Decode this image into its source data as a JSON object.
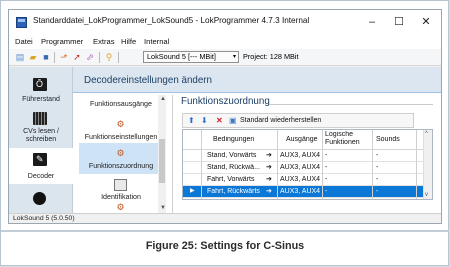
{
  "window": {
    "title": "Standarddatei_LokProgrammer_LokSound5 - LokProgrammer 4.7.3 Internal",
    "controls": [
      "–",
      "☐",
      "✕"
    ]
  },
  "menu": {
    "items": [
      "Datei",
      "Programmer",
      "Extras",
      "Hilfe",
      "Internal"
    ]
  },
  "toolbar": {
    "decoder_select": "LokSound 5 [--- MBit]",
    "project_label": "Project:",
    "project_value": "128 MBit",
    "icons": [
      "new-file-icon",
      "open-folder-icon",
      "save-icon",
      "read-icon",
      "write-icon",
      "undo-icon",
      "tools-icon"
    ]
  },
  "sidebar": {
    "items": [
      {
        "label": "Führerstand",
        "icon": "cab-icon"
      },
      {
        "label": "CVs lesen / schreiben",
        "icon": "cv-icon"
      },
      {
        "label": "Decoder",
        "icon": "decoder-icon",
        "active": true
      },
      {
        "label": "",
        "icon": "sound-icon"
      }
    ]
  },
  "main": {
    "header": "Decodereinstellungen ändern",
    "categories": [
      {
        "label": "Funktionsausgänge"
      },
      {
        "label": "Funktionseinstellungen"
      },
      {
        "label": "Funktionszuordnung",
        "selected": true
      },
      {
        "label": "Identifikation"
      }
    ],
    "section_title": "Funktionszuordnung",
    "restore_label": "Standard wiederherstellen",
    "table": {
      "columns": [
        "Bedingungen",
        "Ausgänge",
        "Logische Funktionen",
        "Sounds"
      ],
      "rows": [
        {
          "bedingungen": "Stand, Vorwärts",
          "ausgaenge": "AUX3, AUX4",
          "logisch": "-",
          "sounds": "-",
          "selected": false
        },
        {
          "bedingungen": "Stand, Rückwä...",
          "ausgaenge": "AUX3, AUX4",
          "logisch": "-",
          "sounds": "-",
          "selected": false
        },
        {
          "bedingungen": "Fahrt, Vorwärts",
          "ausgaenge": "AUX3, AUX4",
          "logisch": "-",
          "sounds": "-",
          "selected": false
        },
        {
          "bedingungen": "Fahrt, Rückwärts",
          "ausgaenge": "AUX3, AUX4",
          "logisch": "-",
          "sounds": "-",
          "selected": true
        }
      ]
    }
  },
  "status": {
    "text": "LokSound 5 (5.0.50)"
  },
  "caption": "Figure 25: Settings for C-Sinus",
  "colors": {
    "accent": "#0b77d7",
    "header_bg": "#dce6f0",
    "sidebar_bg": "#dbe5ee"
  }
}
